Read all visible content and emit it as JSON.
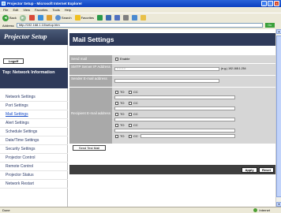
{
  "window": {
    "title": "Projector Setup - Microsoft Internet Explorer",
    "menu": [
      "File",
      "Edit",
      "View",
      "Favorites",
      "Tools",
      "Help"
    ],
    "toolbar": {
      "back": "Back",
      "search": "Search",
      "favorites": "Favorites"
    },
    "address_label": "Address",
    "address_value": "http://192.168.1.10/setup.htm",
    "go_label": "Go",
    "status_left": "Done",
    "status_right": "Internet"
  },
  "sidebar": {
    "logo": "Projector Setup",
    "logoff": "Logoff",
    "section_title": "Top: Network Information",
    "items": [
      "Network Settings",
      "Port Settings",
      "Mail Settings",
      "Alert Settings",
      "Schedule Settings",
      "Date/Time Settings",
      "Security Settings",
      "Projector Control",
      "Remote Control",
      "Projector Status",
      "Network Restart"
    ],
    "active_index": 2
  },
  "main": {
    "title": "Mail Settings",
    "send_mail_label": "Send mail",
    "send_mail_enable": "Enable",
    "smtp_label": "SMTP Server IP Address",
    "smtp_value": "0.0.0.0",
    "smtp_hint": "(e.g.) 192.168.1.254",
    "sender_label": "Sender E-mail address",
    "recipient_label": "Recipient E-mail address",
    "recipients": [
      {
        "to": "TO",
        "cc": "CC"
      },
      {
        "to": "TO",
        "cc": "CC"
      },
      {
        "to": "TO",
        "cc": "CC"
      },
      {
        "to": "TO",
        "cc": "CC"
      },
      {
        "to": "TO",
        "cc": "CC"
      }
    ],
    "send_test_mail": "Send Test Mail",
    "apply": "Apply",
    "reset": "Reset"
  }
}
